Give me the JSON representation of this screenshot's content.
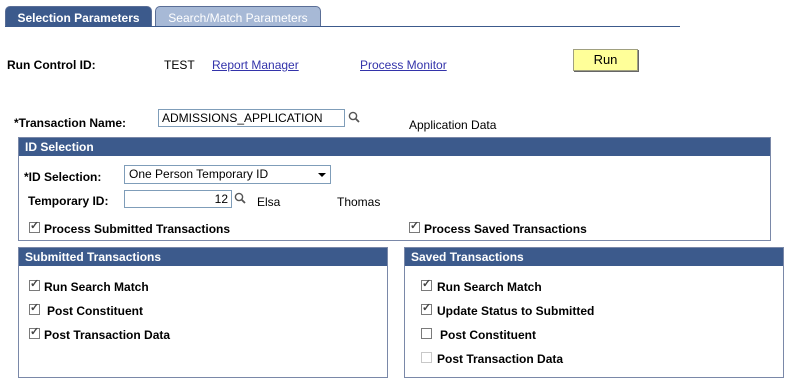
{
  "tabs": {
    "selection": "Selection Parameters",
    "search_match": "Search/Match Parameters"
  },
  "header": {
    "run_control_label": "Run Control ID:",
    "run_control_value": "TEST",
    "report_manager": "Report Manager",
    "process_monitor": "Process Monitor",
    "run_button": "Run"
  },
  "transaction": {
    "label": "*Transaction Name:",
    "value": "ADMISSIONS_APPLICATION",
    "description": "Application Data"
  },
  "id_selection": {
    "title": "ID Selection",
    "id_label": "*ID Selection:",
    "id_value": "One Person Temporary ID",
    "temp_label": "Temporary ID:",
    "temp_value": "12",
    "first_name": "Elsa",
    "last_name": "Thomas",
    "process_submitted": "Process Submitted Transactions",
    "process_saved": "Process Saved Transactions"
  },
  "submitted": {
    "title": "Submitted Transactions",
    "items": [
      {
        "label": "Run Search Match",
        "checked": true
      },
      {
        "label": "Post Constituent",
        "checked": true
      },
      {
        "label": "Post Transaction Data",
        "checked": true
      }
    ]
  },
  "saved": {
    "title": "Saved Transactions",
    "items": [
      {
        "label": "Run Search Match",
        "checked": true
      },
      {
        "label": "Update Status to Submitted",
        "checked": true
      },
      {
        "label": "Post Constituent",
        "checked": false
      },
      {
        "label": "Post Transaction Data",
        "checked": false
      }
    ]
  },
  "colors": {
    "header_blue": "#3c5a8c",
    "button_yellow": "#ffff99"
  }
}
